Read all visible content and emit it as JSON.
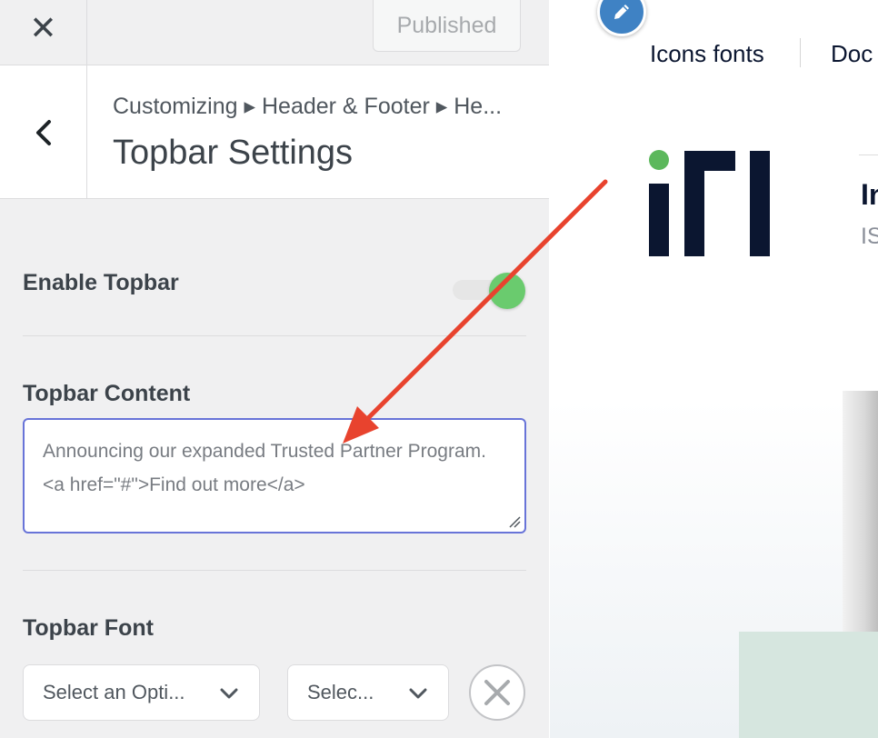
{
  "topbar": {
    "close_glyph": "✕",
    "publish_label": "Published"
  },
  "section": {
    "breadcrumb": "Customizing ▸ Header & Footer ▸ He...",
    "title": "Topbar Settings"
  },
  "controls": {
    "enable_topbar": {
      "label": "Enable Topbar",
      "on": true
    },
    "topbar_content": {
      "label": "Topbar Content",
      "value": "Announcing our expanded Trusted Partner Program. <a  href=\"#\">Find out more</a>"
    },
    "topbar_font": {
      "label": "Topbar Font",
      "family_select": "Select an Opti...",
      "variant_select": "Selec..."
    }
  },
  "preview": {
    "nav_items": [
      "Icons fonts",
      "Doc"
    ],
    "hero_title": "In",
    "hero_subtitle": "IS"
  },
  "colors": {
    "accent_blue": "#6874d8",
    "toggle_on": "#6acb6e",
    "annotation_arrow": "#e8432e",
    "logo_dark": "#0b1630",
    "logo_green": "#5cb85c",
    "edit_icon_bg": "#3f82c4"
  }
}
